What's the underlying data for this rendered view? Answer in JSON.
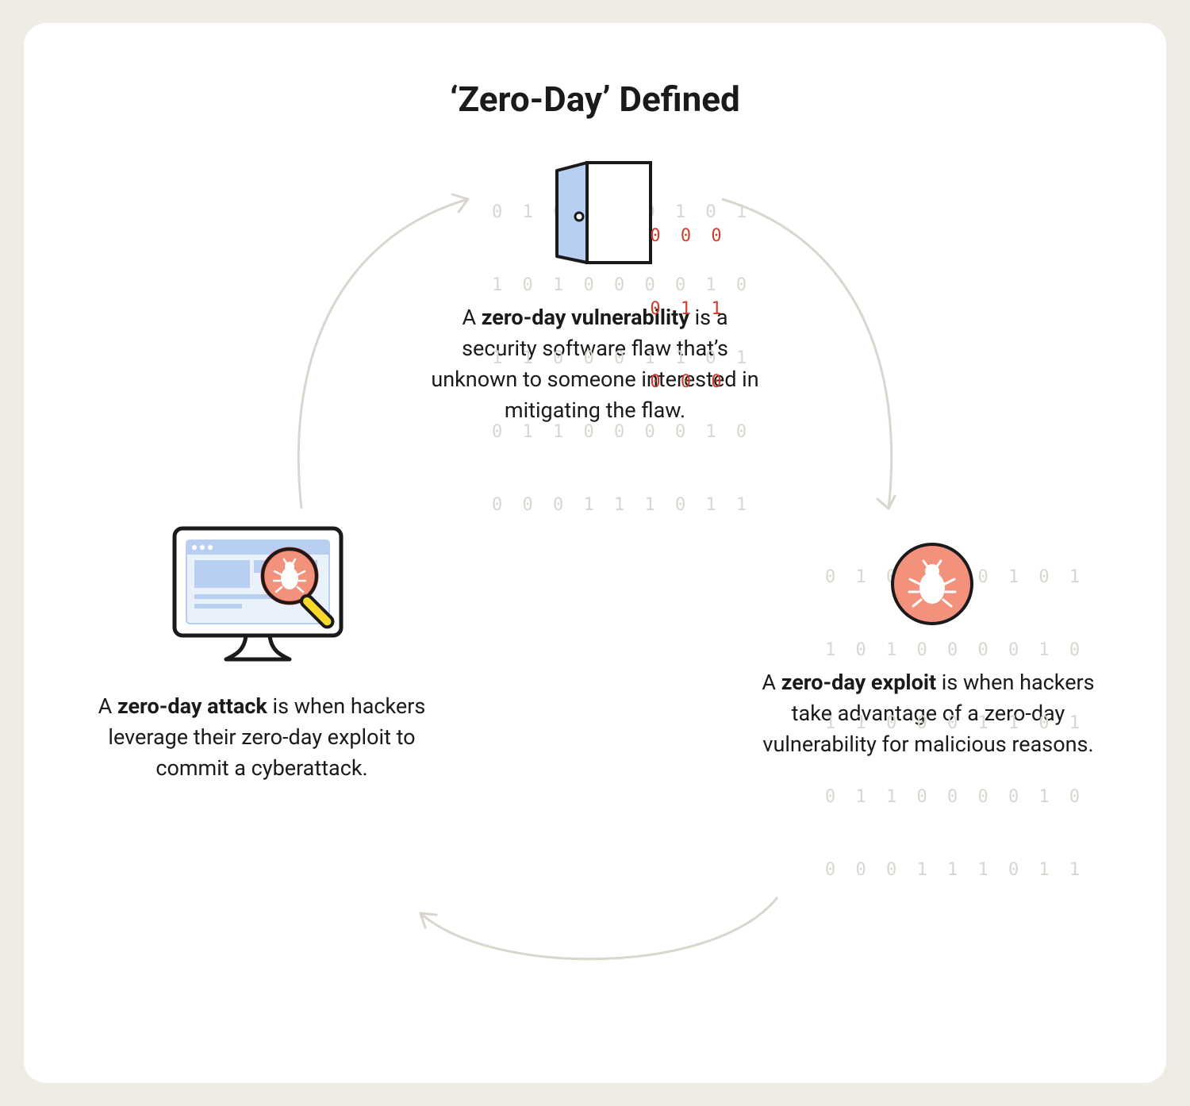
{
  "title": "‘Zero-Day’ Defined",
  "nodes": {
    "vulnerability": {
      "prefix": "A ",
      "term": "zero-day vulnerability",
      "rest": " is a security software flaw that’s unknown to someone interested in mitigating the flaw."
    },
    "exploit": {
      "prefix": "A ",
      "term": "zero-day exploit",
      "rest": " is when hackers take advantage of a zero-day vulnerability for malicious reasons."
    },
    "attack": {
      "prefix": "A ",
      "term": "zero-day attack",
      "rest": " is when hackers leverage their zero-day exploit to commit a cyberattack."
    }
  },
  "codebg_rows": {
    "r1": "0 1 0 0 1 0 1 0 1",
    "r2": "1 0 1 0 0 0 0 1 0",
    "r3": "1 1 0 0 0 1 1 0 1",
    "r4": "0 1 1 0 0 0 0 1 0",
    "r5": "0 0 0 1 1 1 0 1 1"
  },
  "door_rows": {
    "d1": "0 0 0",
    "d2": "0 1 1",
    "d3": "0 0 0"
  },
  "colors": {
    "accent_red": "#d23c2a",
    "accent_salmon": "#f3927c",
    "accent_yellow": "#f9d92a",
    "accent_blue": "#b9cff2",
    "arrow": "#d9d6ce"
  }
}
